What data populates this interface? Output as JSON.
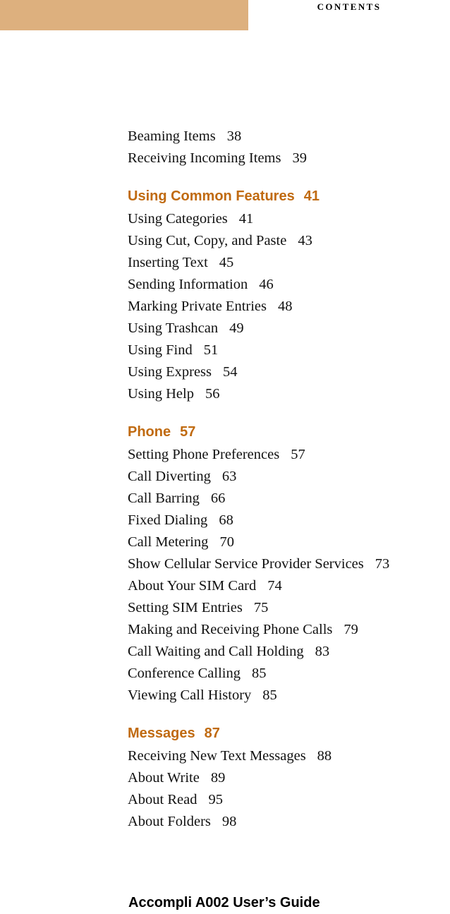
{
  "page": {
    "running_head": "CONTENTS",
    "footer": "Accompli A002 User’s Guide",
    "band_color": "#ddb07e",
    "heading_color": "#c06a10",
    "body_color": "#111111"
  },
  "toc": {
    "groups": [
      {
        "heading": null,
        "entries": [
          {
            "title": "Beaming Items",
            "page": "38"
          },
          {
            "title": "Receiving Incoming Items",
            "page": "39"
          }
        ]
      },
      {
        "heading": {
          "title": "Using Common Features",
          "page": "41"
        },
        "entries": [
          {
            "title": "Using Categories",
            "page": "41"
          },
          {
            "title": "Using Cut, Copy, and Paste",
            "page": "43"
          },
          {
            "title": "Inserting Text",
            "page": "45"
          },
          {
            "title": "Sending Information",
            "page": "46"
          },
          {
            "title": "Marking Private Entries",
            "page": "48"
          },
          {
            "title": "Using Trashcan",
            "page": "49"
          },
          {
            "title": "Using Find",
            "page": "51"
          },
          {
            "title": "Using Express",
            "page": "54"
          },
          {
            "title": "Using Help",
            "page": "56"
          }
        ]
      },
      {
        "heading": {
          "title": "Phone",
          "page": "57"
        },
        "entries": [
          {
            "title": "Setting Phone Preferences",
            "page": "57"
          },
          {
            "title": "Call Diverting",
            "page": "63"
          },
          {
            "title": "Call Barring",
            "page": "66"
          },
          {
            "title": "Fixed Dialing",
            "page": "68"
          },
          {
            "title": "Call Metering",
            "page": "70"
          },
          {
            "title": "Show Cellular Service Provider Services",
            "page": "73"
          },
          {
            "title": "About Your SIM Card",
            "page": "74"
          },
          {
            "title": "Setting SIM Entries",
            "page": "75"
          },
          {
            "title": "Making and Receiving Phone Calls",
            "page": "79"
          },
          {
            "title": "Call Waiting and Call Holding",
            "page": "83"
          },
          {
            "title": "Conference Calling",
            "page": "85"
          },
          {
            "title": "Viewing Call History",
            "page": "85"
          }
        ]
      },
      {
        "heading": {
          "title": "Messages",
          "page": "87"
        },
        "entries": [
          {
            "title": "Receiving New Text Messages",
            "page": "88"
          },
          {
            "title": "About Write",
            "page": "89"
          },
          {
            "title": "About Read",
            "page": "95"
          },
          {
            "title": "About Folders",
            "page": "98"
          }
        ]
      }
    ]
  }
}
